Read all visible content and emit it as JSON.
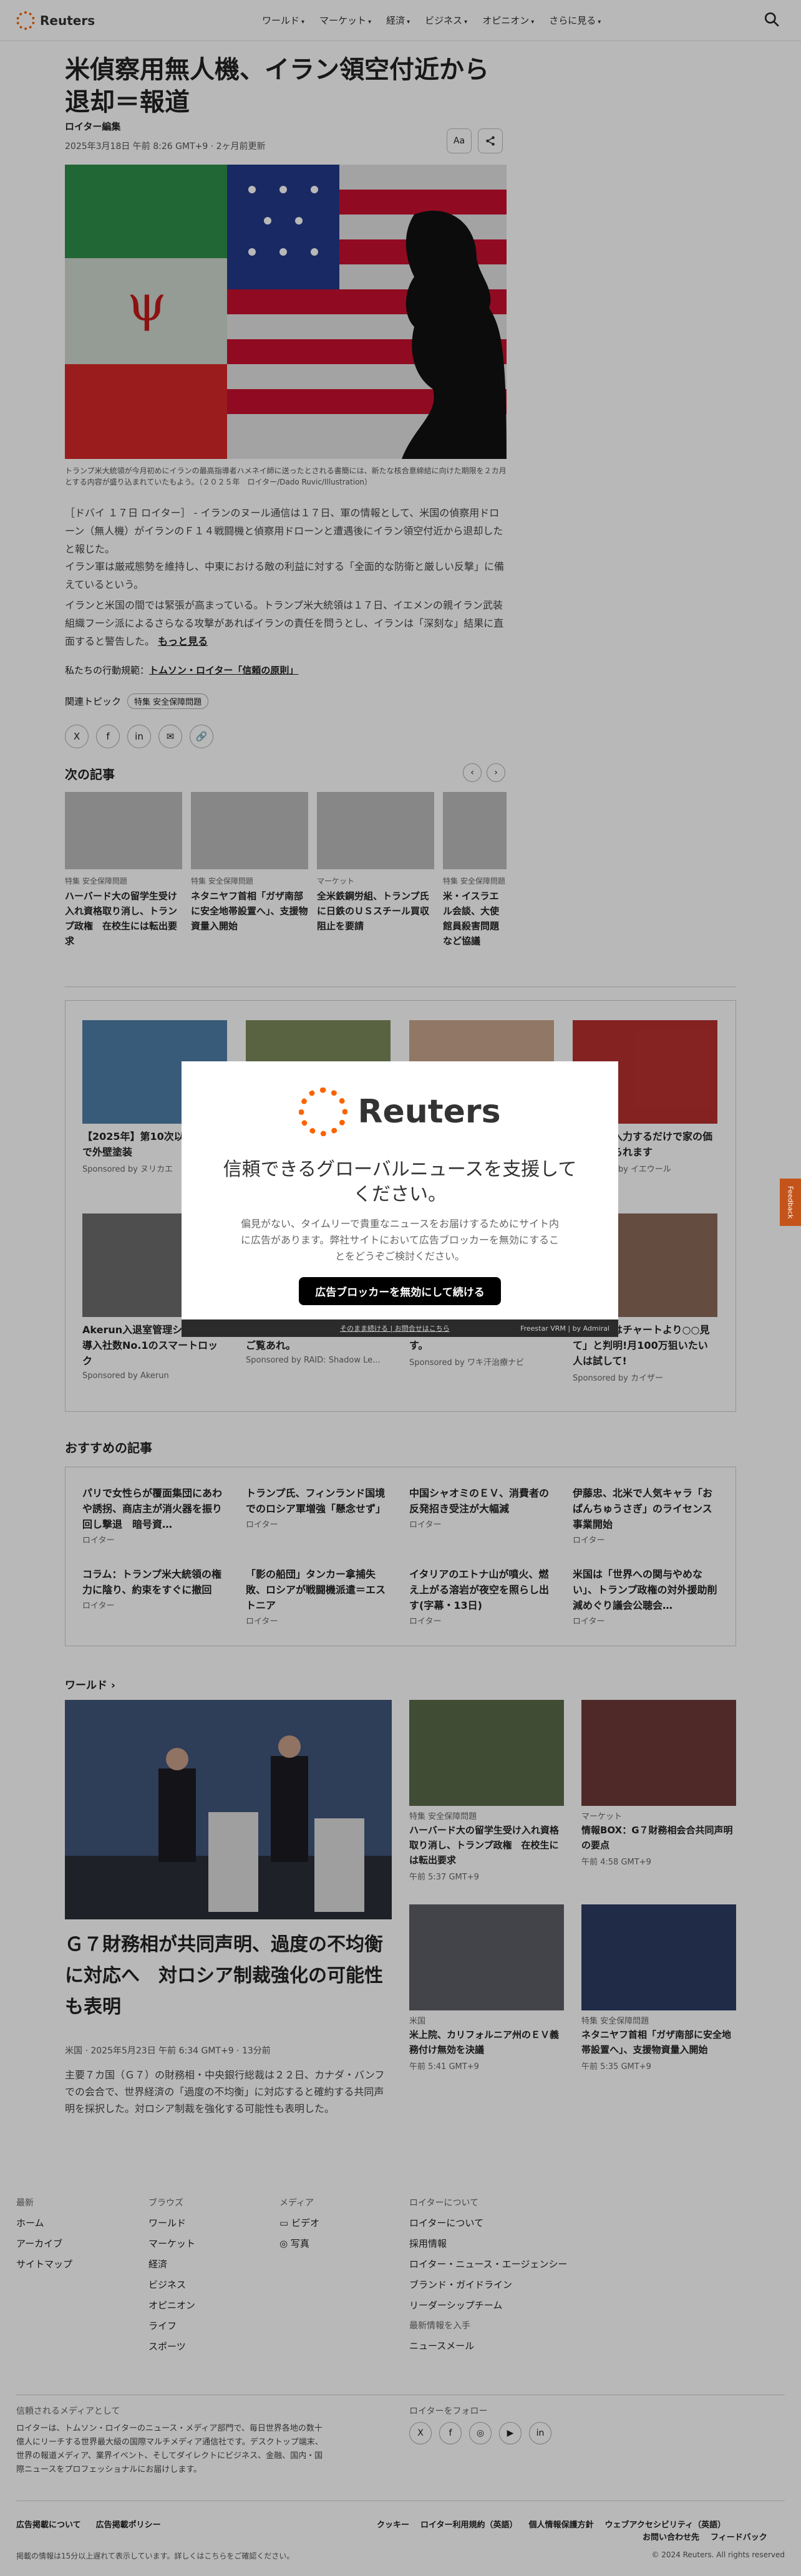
{
  "header": {
    "brand": "Reuters",
    "nav": [
      "ワールド",
      "マーケット",
      "経済",
      "ビジネス",
      "オピニオン",
      "さらに見る"
    ]
  },
  "article": {
    "headline": "米偵察用無人機、イラン領空付近から退却＝報道",
    "byline": "ロイター編集",
    "date": "2025年3月18日 午前 8:26 GMT+9 · 2ヶ月前更新",
    "text_size_label": "Aa",
    "caption": "トランプ米大統領が今月初めにイランの最高指導者ハメネイ師に送ったとされる書簡には、新たな核合意締結に向けた期限を２カ月とする内容が盛り込まれていたもよう。（２０２５年　ロイター/Dado Ruvic/Illustration）",
    "paragraphs": [
      "［ドバイ １７日 ロイター］ - イランのヌール通信は１７日、軍の情報として、米国の偵察用ドローン（無人機）がイランのＦ１４戦闘機と偵察用ドローンと遭遇後にイラン領空付近から退却したと報じた。",
      "イラン軍は厳戒態勢を維持し、中東における敵の利益に対する「全面的な防衛と厳しい反撃」に備えているという。",
      "イランと米国の間では緊張が高まっている。トランプ米大統領は１７日、イエメンの親イラン武装組織フーシ派によるさらなる攻撃があればイランの責任を問うとし、イランは「深刻な」結果に直面すると警告した。"
    ],
    "more": "もっと見る",
    "principles_prefix": "私たちの行動規範：",
    "principles_link": "トムソン・ロイター「信頼の原則」",
    "topics_label": "関連トピック",
    "topic": "特集 安全保障問題"
  },
  "next": {
    "title": "次の記事",
    "cards": [
      {
        "tag": "特集 安全保障問題",
        "title": "ハーバード大の留学生受け入れ資格取り消し、トランプ政権　在校生には転出要求"
      },
      {
        "tag": "特集 安全保障問題",
        "title": "ネタニヤフ首相「ガザ南部に安全地帯設置へ」、支援物資量入開始"
      },
      {
        "tag": "マーケット",
        "title": "全米鉄鋼労組、トランプ氏に日鉄のＵＳスチール買収阻止を要請"
      },
      {
        "tag": "特集 安全保障問題",
        "title": "米・イスラエル会談、大使館員殺害問題など協議"
      }
    ]
  },
  "ads": [
    {
      "title": "【2025年】第10次以上助成金で外壁塗装",
      "sponsor": "Sponsored by ヌリカエ"
    },
    {
      "title": "",
      "sponsor": ""
    },
    {
      "title": "",
      "sponsor": ""
    },
    {
      "title": "医所など入力するだけで家の価値を調べられます",
      "sponsor": "Sponsored by イエウール"
    },
    {
      "title": "Akerun入退室管理システム｜導入社数No.1のスマートロック",
      "sponsor": "Sponsored by Akerun"
    },
    {
      "title": "ゲームを秘密にしている理由をご覧あれ。",
      "sponsor": "Sponsored by RAID: Shadow Le..."
    },
    {
      "title": "ニックで診療が行われています。",
      "sponsor": "Sponsored by ワキ汗治療ナビ"
    },
    {
      "title": "の買い時はチャートより○○見て」と判明!月100万狙いたい人は試して!",
      "sponsor": "Sponsored by カイザー"
    }
  ],
  "modal": {
    "brand": "Reuters",
    "heading": "信頼できるグローバルニュースを支援してください。",
    "body": "偏見がない、タイムリーで貴重なニュースをお届けするためにサイト内に広告があります。弊社サイトにおいて広告ブロッカーを無効にすることをどうぞご検討ください。",
    "button": "広告ブロッカーを無効にして続ける",
    "footer_left": "そのまま続ける | お問合せはこちら",
    "footer_right": "Freestar VRM | by Admiral"
  },
  "feedback": "Feedback",
  "recommended": {
    "title": "おすすめの記事",
    "items": [
      {
        "title": "パリで女性らが覆面集団にあわや誘拐、商店主が消火器を振り回し撃退　暗号資…",
        "src": "ロイター"
      },
      {
        "title": "トランプ氏、フィンランド国境でのロシア軍増強「懸念せず」",
        "src": "ロイター"
      },
      {
        "title": "中国シャオミのＥＶ、消費者の反発招き受注が大幅減",
        "src": "ロイター"
      },
      {
        "title": "伊藤忠、北米で人気キャラ「おぱんちゅうさぎ」のライセンス事業開始",
        "src": "ロイター"
      },
      {
        "title": "コラム：トランプ米大統領の権力に陰り、約束をすぐに撤回",
        "src": "ロイター"
      },
      {
        "title": "「影の船団」タンカー拿捕失敗、ロシアが戦闘機派遣＝エストニア",
        "src": "ロイター"
      },
      {
        "title": "イタリアのエトナ山が噴火、燃え上がる溶岩が夜空を照らし出す(字幕・13日)",
        "src": "ロイター"
      },
      {
        "title": "米国は「世界への関与やめない」、トランプ政権の対外援助削減めぐり議会公聴会…",
        "src": "ロイター"
      }
    ]
  },
  "world": {
    "title": "ワールド",
    "feature": {
      "title": "Ｇ７財務相が共同声明、過度の不均衡に対応へ　対ロシア制裁強化の可能性も表明",
      "date": "米国 · 2025年5月23日 午前 6:34 GMT+9 · 13分前",
      "summary": "主要７カ国（Ｇ７）の財務相・中央銀行総裁は２２日、カナダ・バンフでの会合で、世界経済の「過度の不均衡」に対応すると確約する共同声明を採択した。対ロシア制裁を強化する可能性も表明した。"
    },
    "items": [
      {
        "tag": "特集 安全保障問題",
        "title": "ハーバード大の留学生受け入れ資格取り消し、トランプ政権　在校生には転出要求",
        "date": "午前 5:37 GMT+9"
      },
      {
        "tag": "マーケット",
        "title": "情報BOX：G７財務相会合共同声明の要点",
        "date": "午前 4:58 GMT+9"
      },
      {
        "tag": "米国",
        "title": "米上院、カリフォルニア州のＥＶ義務付け無効を決議",
        "date": "午前 5:41 GMT+9"
      },
      {
        "tag": "特集 安全保障問題",
        "title": "ネタニヤフ首相「ガザ南部に安全地帯設置へ」、支援物資量入開始",
        "date": "午前 5:35 GMT+9"
      }
    ]
  },
  "footer": {
    "col1": [
      "ホーム",
      "アーカイブ",
      "サイトマップ"
    ],
    "col1_head": "最新",
    "col2_head": "ブラウズ",
    "col2": [
      "ワールド",
      "マーケット",
      "経済",
      "ビジネス",
      "オピニオン",
      "ライフ",
      "スポーツ"
    ],
    "col3_head": "メディア",
    "col3": [
      "ビデオ",
      "写真"
    ],
    "col4_head": "ロイターについて",
    "col4": [
      "ロイターについて",
      "採用情報",
      "ロイター・ニュース・エージェンシー",
      "ブランド・ガイドライン",
      "リーダーシップチーム"
    ],
    "col4b_head": "最新情報を入手",
    "col4b": [
      "ニュースメール"
    ],
    "trust_head": "信頼されるメディアとして",
    "trust": "ロイターは、トムソン・ロイターのニュース・メディア部門で、毎日世界各地の数十億人にリーチする世界最大級の国際マルチメディア通信社です。デスクトップ端末、世界の報道メディア、業界イベント、そしてダイレクトにビジネス、金融、国内・国際ニュースをプロフェッショナルにお届けします。",
    "follow_head": "ロイターをフォロー",
    "links_left": [
      "広告掲載について",
      "広告掲載ポリシー"
    ],
    "links_right": [
      "クッキー",
      "ロイター利用規約（英語）",
      "個人情報保護方針",
      "ウェブアクセシビリティ（英語）",
      "お問い合わせ先",
      "フィードバック"
    ],
    "delay": "掲載の情報は15分以上遅れて表示しています。詳しくはこちらをご確認ください。",
    "copyright": "© 2024 Reuters. All rights reserved"
  }
}
